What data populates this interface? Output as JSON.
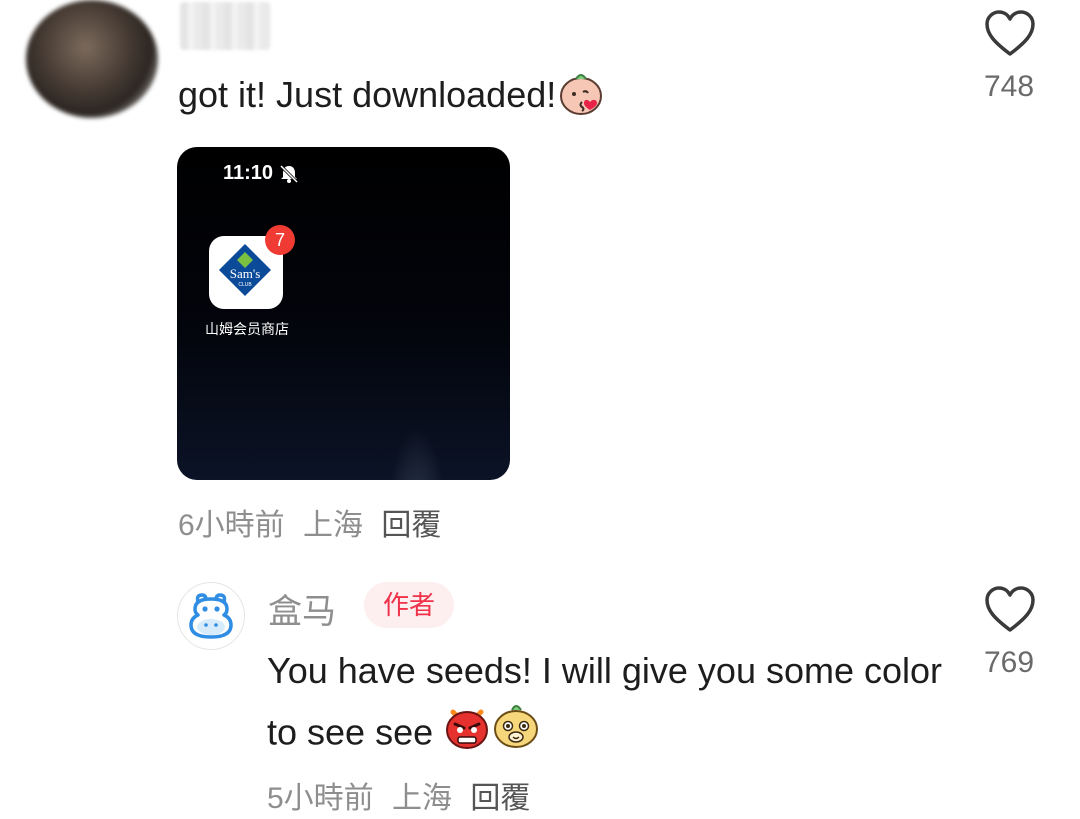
{
  "comment": {
    "text": "got it! Just downloaded!",
    "emoji_icon": "shy-kiss-emoji-icon",
    "likes": "748",
    "image": {
      "time": "11:10",
      "status_icon": "bell-off-icon",
      "app_name": "山姆会员商店",
      "app_logo_text": "Sam's",
      "app_logo_subtext": "CLUB",
      "badge_count": "7"
    },
    "meta": {
      "time": "6小時前",
      "location": "上海",
      "reply": "回覆"
    }
  },
  "reply": {
    "avatar_icon": "hippo-avatar-icon",
    "name": "盒马",
    "author_tag": "作者",
    "text": "You have seeds! I will give you some color to see see",
    "emoji_icons": [
      "angry-face-emoji-icon",
      "smug-face-emoji-icon"
    ],
    "likes": "769",
    "meta": {
      "time": "5小時前",
      "location": "上海",
      "reply": "回覆"
    }
  },
  "colors": {
    "author_tag_bg": "#fdeef0",
    "author_tag_text": "#f0314a",
    "badge": "#ef3b33",
    "hippo_blue": "#2f8de4"
  }
}
